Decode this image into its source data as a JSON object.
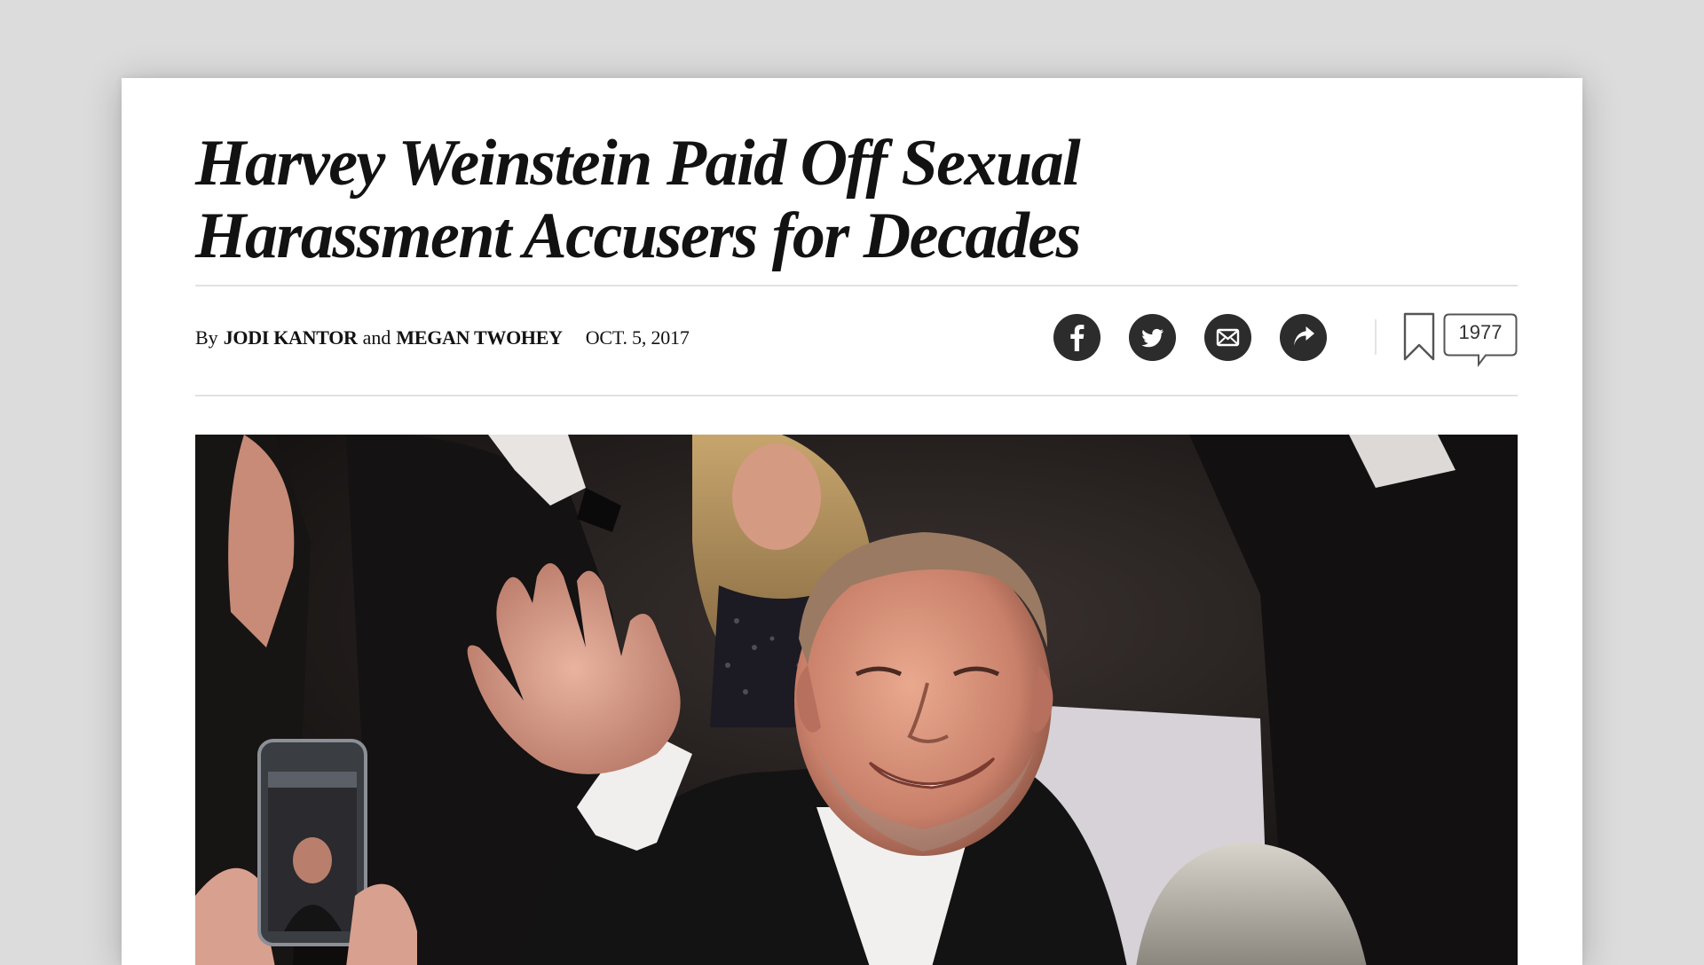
{
  "article": {
    "headline_line1": "Harvey Weinstein Paid Off Sexual",
    "headline_line2": "Harassment Accusers for Decades",
    "byline": {
      "by": "By",
      "author1": "JODI KANTOR",
      "and": "and",
      "author2": "MEGAN TWOHEY",
      "date": "OCT. 5, 2017"
    },
    "share": {
      "icons": [
        "facebook-icon",
        "twitter-icon",
        "email-icon",
        "share-arrow-icon"
      ],
      "bookmark_icon": "bookmark-icon",
      "comment_count": "1977"
    },
    "photo": {
      "subject": "man waving at red carpet event, person filming with phone"
    }
  },
  "colors": {
    "page_background": "#dcdcdc",
    "card_background": "#ffffff",
    "headline": "#121212",
    "icon_fill": "#2c2c2c",
    "rule": "#e2e2e2"
  }
}
